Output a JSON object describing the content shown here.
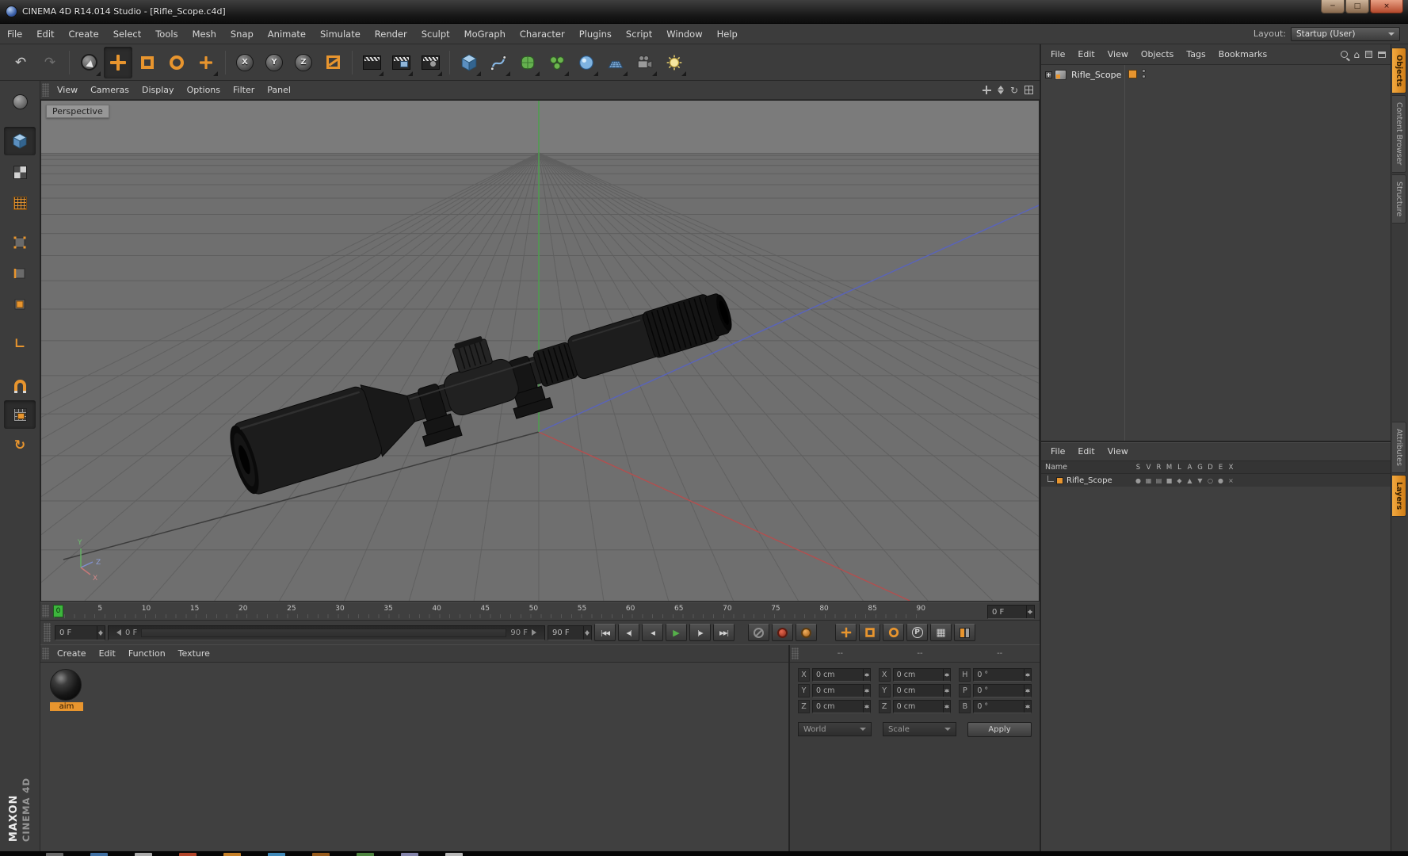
{
  "window": {
    "title": "CINEMA 4D R14.014 Studio - [Rifle_Scope.c4d]",
    "minimize": "─",
    "maximize": "□",
    "close": "×"
  },
  "menu_bar": {
    "items": [
      "File",
      "Edit",
      "Create",
      "Select",
      "Tools",
      "Mesh",
      "Snap",
      "Animate",
      "Simulate",
      "Render",
      "Sculpt",
      "MoGraph",
      "Character",
      "Plugins",
      "Script",
      "Window",
      "Help"
    ],
    "layout_label": "Layout:",
    "layout_value": "Startup (User)"
  },
  "glyphs": {
    "undo": "↶",
    "redo": "↷",
    "home": "⌂",
    "rotate": "↻"
  },
  "toolbar": {
    "axis_locks": [
      "X",
      "Y",
      "Z"
    ]
  },
  "left_palette": {
    "axis_glyph": "∟",
    "rotate_glyph": "↻"
  },
  "viewport": {
    "menus": [
      "View",
      "Cameras",
      "Display",
      "Options",
      "Filter",
      "Panel"
    ],
    "view_label": "Perspective",
    "axis_labels": {
      "x": "X",
      "y": "Y",
      "z": "Z"
    }
  },
  "timeline": {
    "labels": [
      "0",
      "5",
      "10",
      "15",
      "20",
      "25",
      "30",
      "35",
      "40",
      "45",
      "50",
      "55",
      "60",
      "65",
      "70",
      "75",
      "80",
      "85",
      "90"
    ],
    "marker_frame": "0",
    "spinner_value": "0 F"
  },
  "transport": {
    "current_frame": "0 F",
    "range_start": "0 F",
    "range_end": "90 F",
    "end_frame": "90 F",
    "buttons": {
      "goto_start": "|◀◀",
      "prev_key": "◀|",
      "prev_frame": "◀",
      "play": "▶",
      "next_frame": "|▶",
      "goto_end": "▶▶|"
    },
    "parameter_label": "P",
    "pla_glyph": "▦"
  },
  "materials": {
    "menus": [
      "Create",
      "Edit",
      "Function",
      "Texture"
    ],
    "items": [
      {
        "name": "aim"
      }
    ]
  },
  "coordinates": {
    "group_headers": [
      "--",
      "--",
      "--"
    ],
    "cells": [
      {
        "label": "X",
        "value": "0 cm"
      },
      {
        "label": "X",
        "value": "0 cm"
      },
      {
        "label": "H",
        "value": "0 °"
      },
      {
        "label": "Y",
        "value": "0 cm"
      },
      {
        "label": "Y",
        "value": "0 cm"
      },
      {
        "label": "P",
        "value": "0 °"
      },
      {
        "label": "Z",
        "value": "0 cm"
      },
      {
        "label": "Z",
        "value": "0 cm"
      },
      {
        "label": "B",
        "value": "0 °"
      }
    ],
    "mode_dropdown": "World",
    "scale_dropdown": "Scale",
    "apply_label": "Apply"
  },
  "object_manager": {
    "menus": [
      "File",
      "Edit",
      "View",
      "Objects",
      "Tags",
      "Bookmarks"
    ],
    "objects": [
      {
        "name": "Rifle_Scope"
      }
    ]
  },
  "layer_manager": {
    "menus": [
      "File",
      "Edit",
      "View"
    ],
    "name_header": "Name",
    "columns": [
      "S",
      "V",
      "R",
      "M",
      "L",
      "A",
      "G",
      "D",
      "E",
      "X"
    ],
    "rows": [
      {
        "name": "Rifle_Scope"
      }
    ],
    "toggle_glyphs": [
      "●",
      "▦",
      "▤",
      "■",
      "◆",
      "▲",
      "▼",
      "○",
      "●",
      "×"
    ]
  },
  "side_tabs": {
    "objects": "Objects",
    "content_browser": "Content Browser",
    "structure": "Structure",
    "attributes": "Attributes",
    "layers": "Layers"
  },
  "branding": {
    "maxon": "MAXON",
    "cinema": "CINEMA 4D"
  },
  "colors": {
    "accent_orange": "#e8952e",
    "play_green": "#55b04a",
    "marker_green": "#3db53d",
    "axis_x_red": "#b05050",
    "axis_y_green": "#4d9f4d",
    "axis_z_blue": "#5a64b8"
  }
}
